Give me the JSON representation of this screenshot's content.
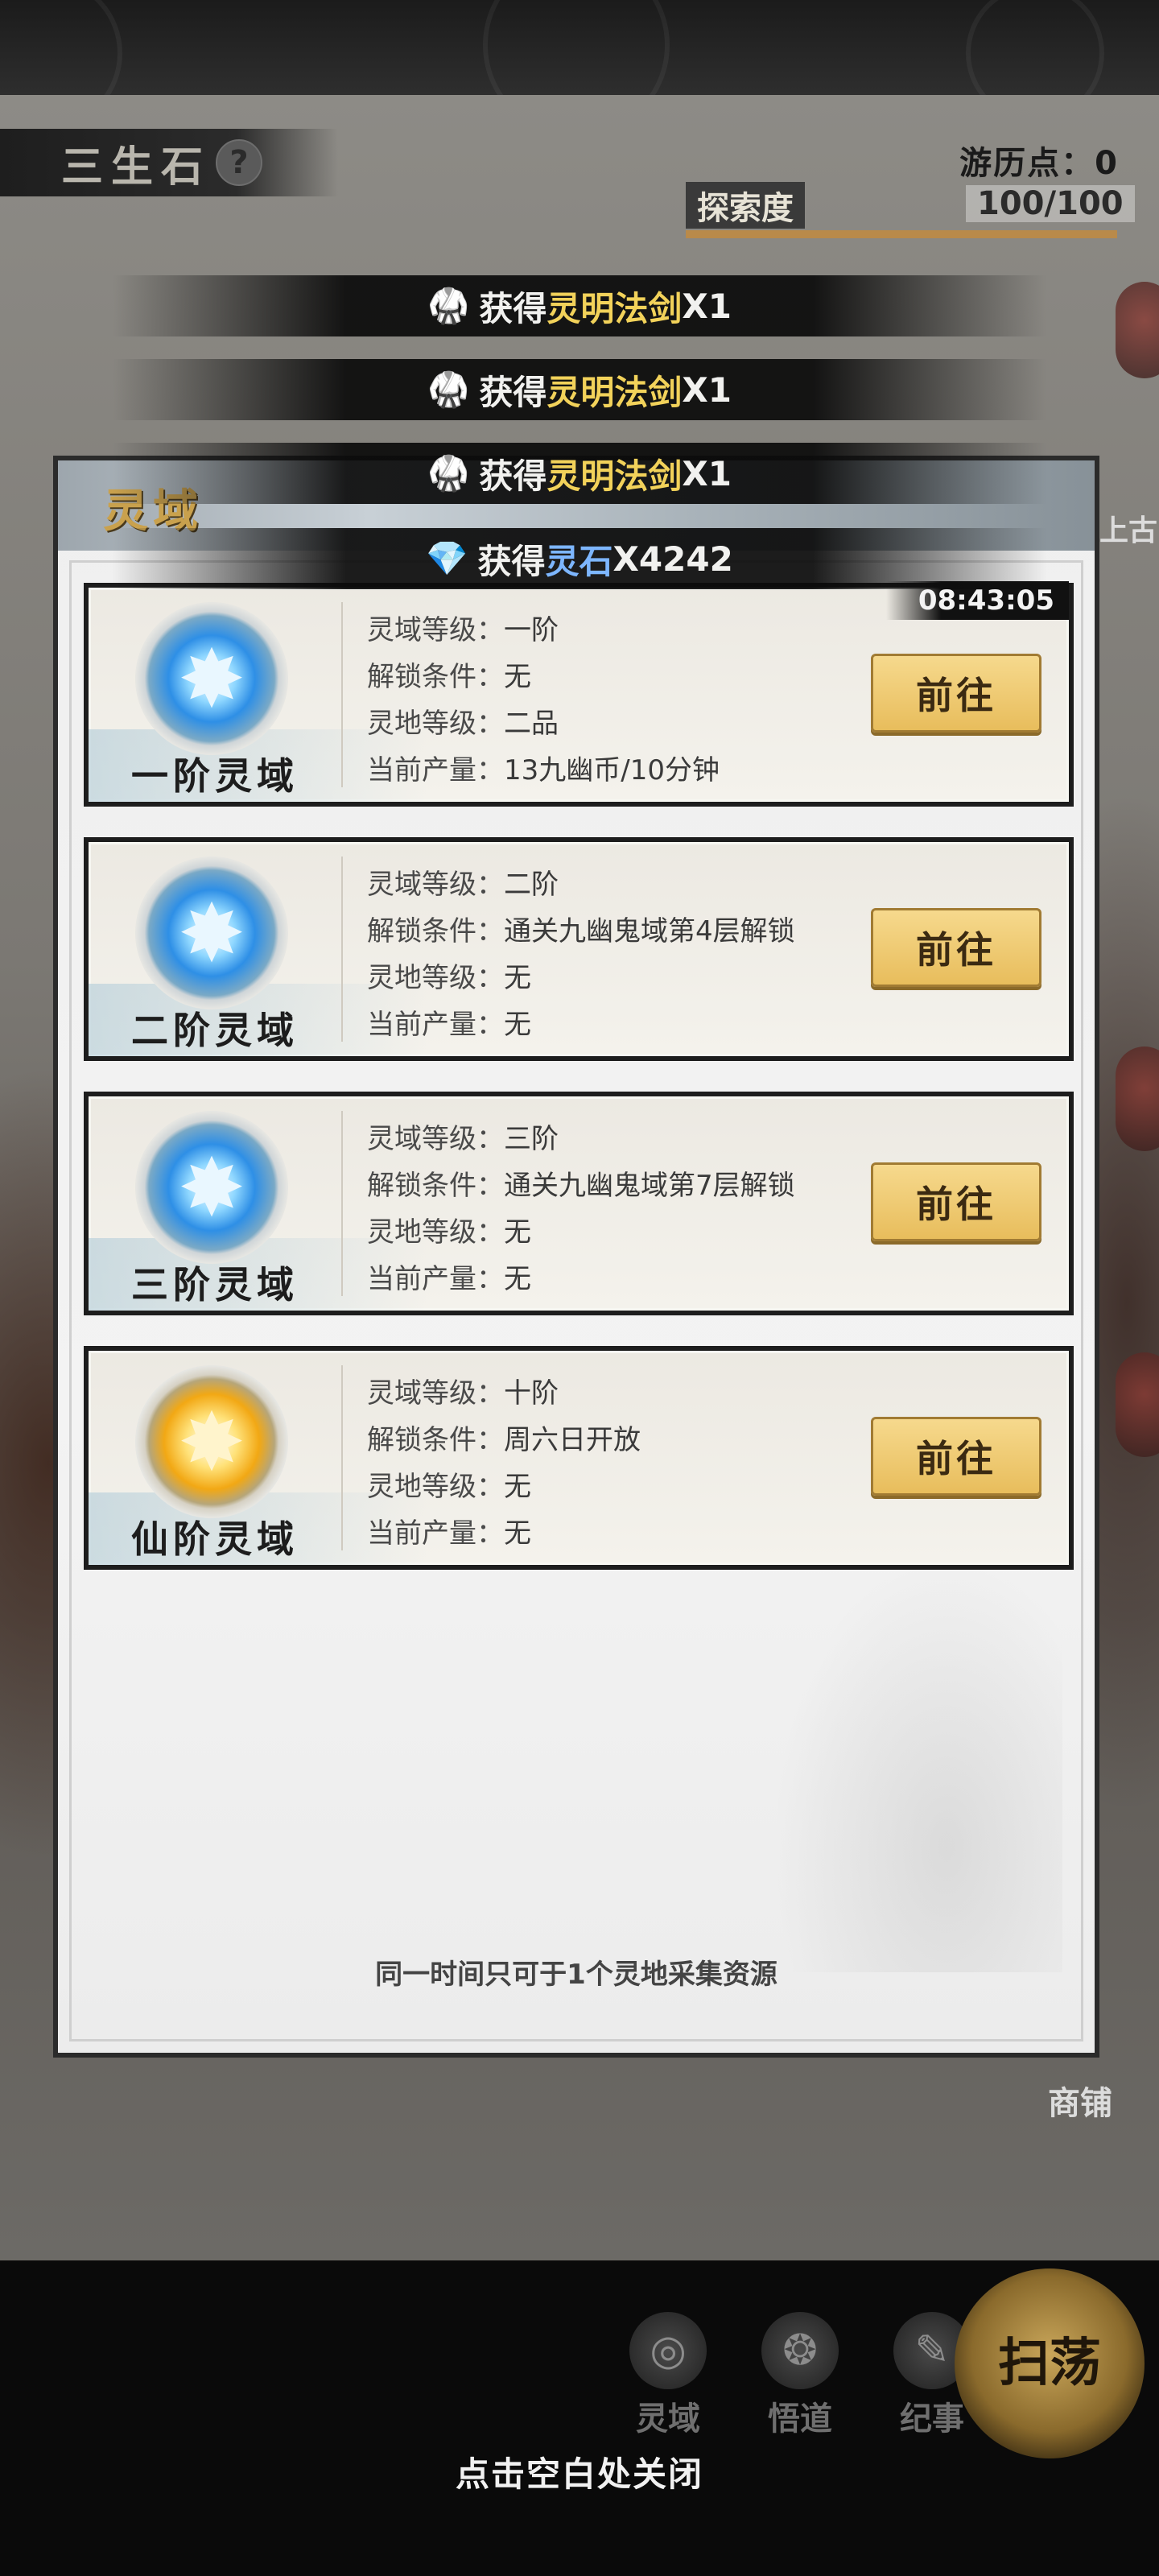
{
  "header": {
    "title": "三生石",
    "help_symbol": "?",
    "travel_points": "游历点：0",
    "explore_label": "探索度",
    "explore_value": "100/100",
    "explore_progress": 1.0
  },
  "toasts": [
    {
      "prefix": "获得",
      "item": "灵明法剑",
      "count": "X1",
      "icon": "robe-icon"
    },
    {
      "prefix": "获得",
      "item": "灵明法剑",
      "count": "X1",
      "icon": "robe-icon"
    },
    {
      "prefix": "获得",
      "item": "灵明法剑",
      "count": "X1",
      "icon": "robe-icon"
    },
    {
      "prefix": "获得",
      "item": "灵石",
      "count": "X4242",
      "icon": "spirit-stone-icon"
    }
  ],
  "panel": {
    "title": "灵域",
    "footer": "同一时间只可于1个灵地采集资源",
    "cards": [
      {
        "name": "一阶灵域",
        "orb": "blue-orb-icon",
        "timer": "08:43:05",
        "lines": [
          {
            "label": "灵域等级：",
            "value": "一阶"
          },
          {
            "label": "解锁条件：",
            "value": "无"
          },
          {
            "label": "灵地等级：",
            "value": "二品"
          },
          {
            "label": "当前产量：",
            "value": "13九幽币/10分钟"
          }
        ],
        "button": "前往"
      },
      {
        "name": "二阶灵域",
        "orb": "blue-orb-icon",
        "lines": [
          {
            "label": "灵域等级：",
            "value": "二阶"
          },
          {
            "label": "解锁条件：",
            "value": "通关九幽鬼域第4层解锁"
          },
          {
            "label": "灵地等级：",
            "value": "无"
          },
          {
            "label": "当前产量：",
            "value": "无"
          }
        ],
        "button": "前往"
      },
      {
        "name": "三阶灵域",
        "orb": "blue-orb-icon",
        "lines": [
          {
            "label": "灵域等级：",
            "value": "三阶"
          },
          {
            "label": "解锁条件：",
            "value": "通关九幽鬼域第7层解锁"
          },
          {
            "label": "灵地等级：",
            "value": "无"
          },
          {
            "label": "当前产量：",
            "value": "无"
          }
        ],
        "button": "前往"
      },
      {
        "name": "仙阶灵域",
        "orb": "gold-orb-icon",
        "lines": [
          {
            "label": "灵域等级：",
            "value": "十阶"
          },
          {
            "label": "解锁条件：",
            "value": "周六日开放"
          },
          {
            "label": "灵地等级：",
            "value": "无"
          },
          {
            "label": "当前产量：",
            "value": "无"
          }
        ],
        "button": "前往"
      }
    ]
  },
  "side": {
    "right_label_1": "上古",
    "right_label_2": "商铺"
  },
  "bottom": {
    "tabs": [
      {
        "label": "灵域",
        "icon": "spirit-domain-icon"
      },
      {
        "label": "悟道",
        "icon": "enlightenment-icon"
      },
      {
        "label": "纪事",
        "icon": "chronicle-icon"
      }
    ],
    "sweep": "扫荡",
    "close_hint": "点击空白处关闭"
  }
}
